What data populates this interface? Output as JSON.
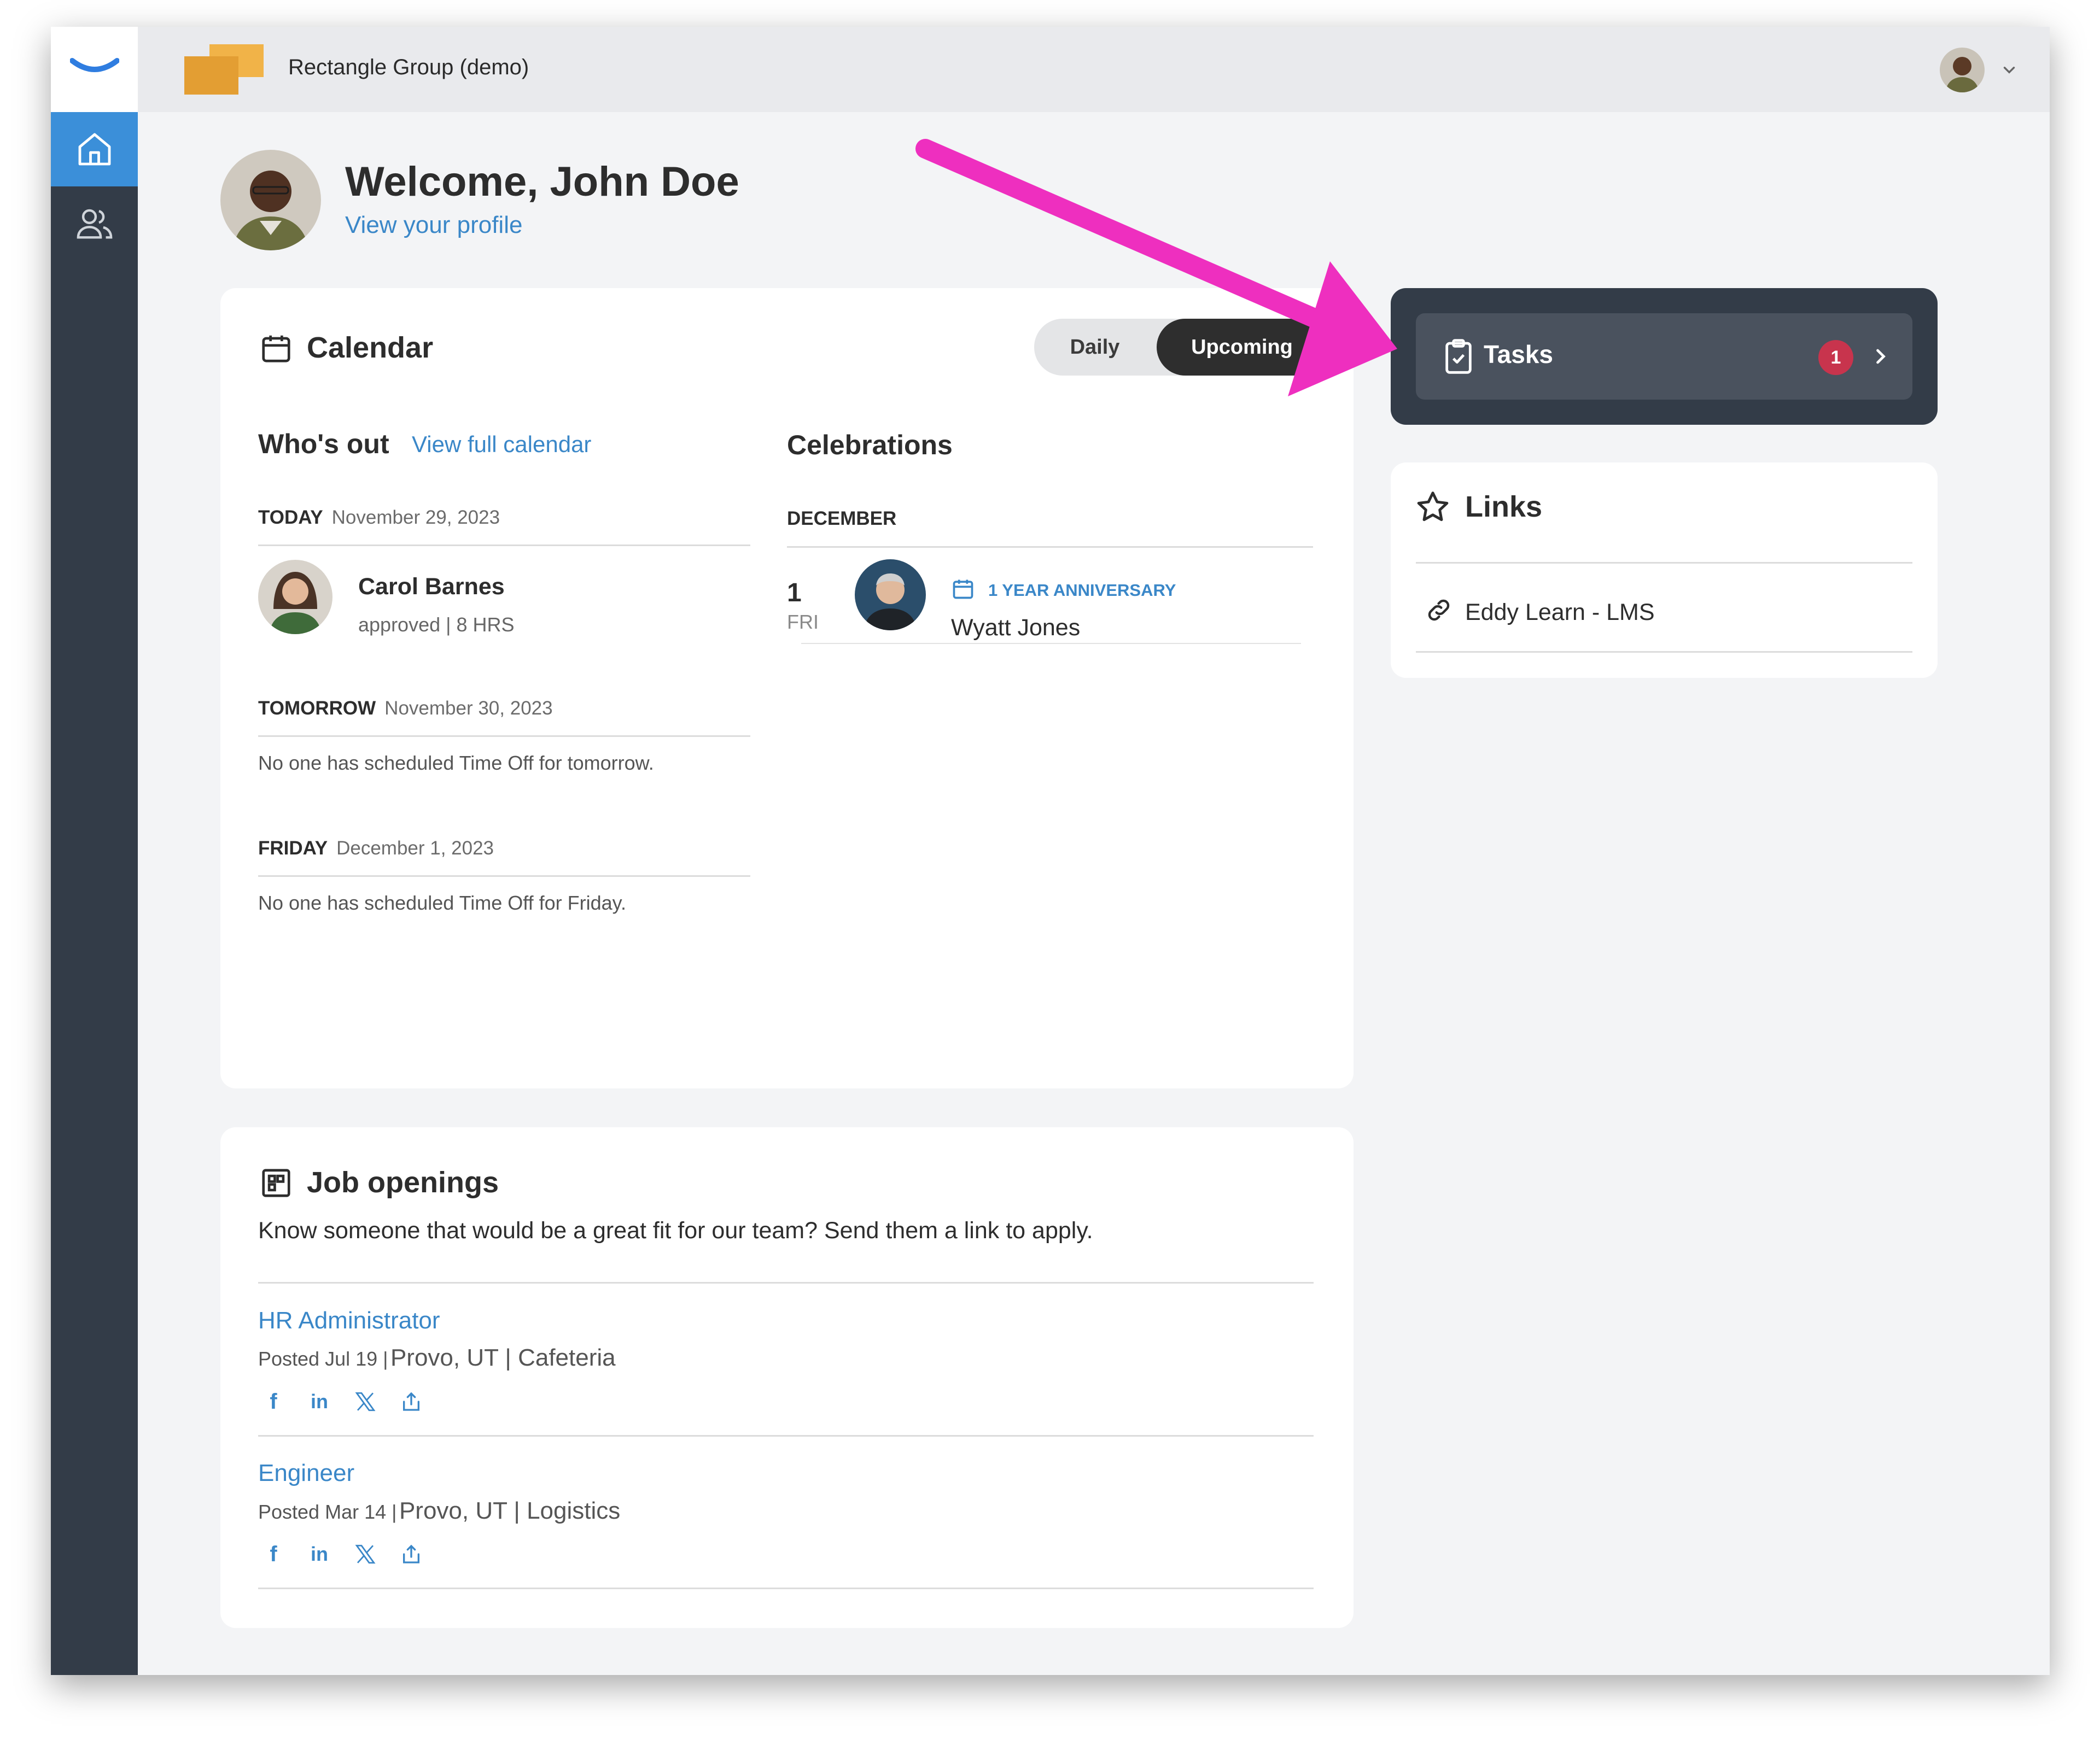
{
  "topbar": {
    "company_name": "Rectangle Group (demo)"
  },
  "sidebar": {
    "items": [
      {
        "icon": "home-icon",
        "active": true
      },
      {
        "icon": "people-icon",
        "active": false
      }
    ]
  },
  "welcome": {
    "title": "Welcome, John Doe",
    "profile_link": "View your profile"
  },
  "calendar": {
    "title": "Calendar",
    "toggle": {
      "daily": "Daily",
      "upcoming": "Upcoming",
      "selected": "Upcoming"
    },
    "whos_out": {
      "title": "Who's out",
      "view_full_link": "View full calendar",
      "days": [
        {
          "label": "TODAY",
          "date": "November 29, 2023",
          "entries": [
            {
              "name": "Carol Barnes",
              "detail": "approved | 8 HRS"
            }
          ]
        },
        {
          "label": "TOMORROW",
          "date": "November 30, 2023",
          "empty_text": "No one has scheduled Time Off for tomorrow."
        },
        {
          "label": "FRIDAY",
          "date": "December 1, 2023",
          "empty_text": "No one has scheduled Time Off for Friday."
        }
      ]
    },
    "celebrations": {
      "title": "Celebrations",
      "month": "DECEMBER",
      "items": [
        {
          "day": "1",
          "weekday": "FRI",
          "type": "1 YEAR ANNIVERSARY",
          "name": "Wyatt Jones"
        }
      ]
    }
  },
  "tasks": {
    "label": "Tasks",
    "count": "1"
  },
  "links": {
    "title": "Links",
    "items": [
      {
        "label": "Eddy Learn - LMS"
      }
    ]
  },
  "jobs": {
    "title": "Job openings",
    "description": "Know someone that would be a great fit for our team? Send them a link to apply.",
    "items": [
      {
        "title": "HR Administrator",
        "posted": "Posted Jul 19 |",
        "location": "Provo, UT | Cafeteria"
      },
      {
        "title": "Engineer",
        "posted": "Posted Mar 14 |",
        "location": "Provo, UT | Logistics"
      }
    ]
  },
  "colors": {
    "accent": "#3a87c8",
    "sidebar": "#333c48",
    "badge": "#c8344d",
    "arrow": "#ee2fbf"
  }
}
